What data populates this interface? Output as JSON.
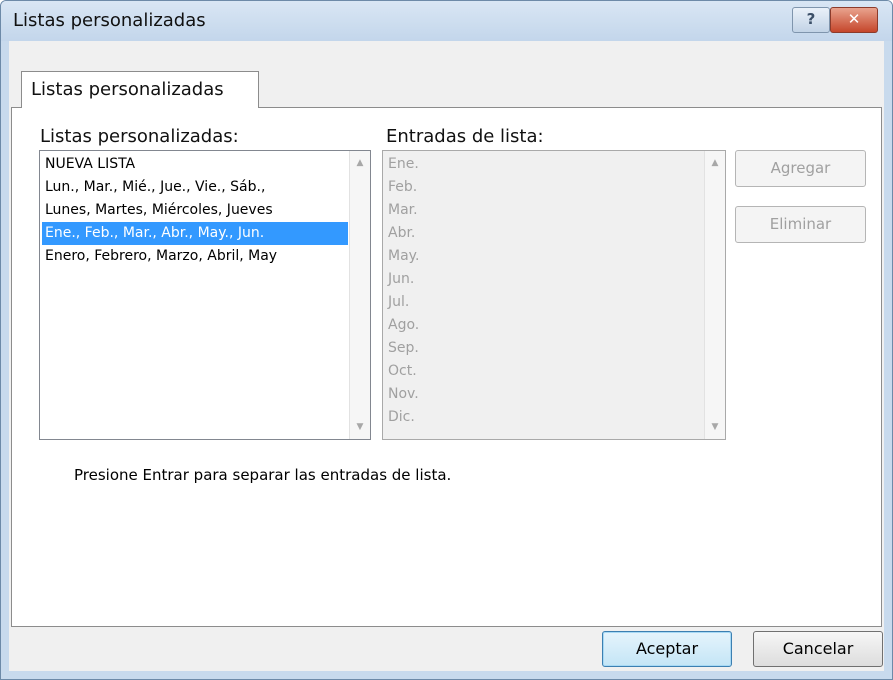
{
  "window": {
    "title": "Listas personalizadas",
    "help_glyph": "?",
    "close_glyph": "✕"
  },
  "tab": {
    "label": "Listas personalizadas"
  },
  "custom_lists": {
    "label": "Listas personalizadas:",
    "items": [
      "NUEVA LISTA",
      "Lun., Mar., Mié., Jue., Vie., Sáb., ",
      "Lunes, Martes, Miércoles, Jueves",
      "Ene., Feb., Mar., Abr., May., Jun.",
      "Enero, Febrero, Marzo, Abril, May"
    ],
    "selected_index": 3
  },
  "list_entries": {
    "label": "Entradas de lista:",
    "items": [
      "Ene.",
      "Feb.",
      "Mar.",
      "Abr.",
      "May.",
      "Jun.",
      "Jul.",
      "Ago.",
      "Sep.",
      "Oct.",
      "Nov.",
      "Dic."
    ]
  },
  "scroll_arrows": {
    "up": "▲",
    "down": "▼"
  },
  "buttons": {
    "add": "Agregar",
    "delete": "Eliminar",
    "ok": "Aceptar",
    "cancel": "Cancelar"
  },
  "hint": "Presione Entrar para separar las entradas de lista.",
  "colors": {
    "selection": "#3399ff",
    "title_bar": "#c8daed",
    "close_button": "#c5462b"
  }
}
